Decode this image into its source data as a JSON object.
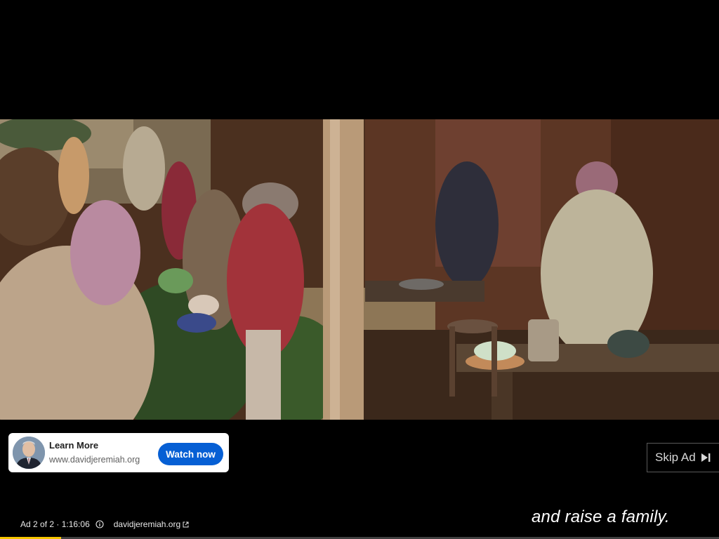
{
  "ad_card": {
    "title": "Learn More",
    "url": "www.davidjeremiah.org",
    "cta_label": "Watch now",
    "cta_color": "#065fd4"
  },
  "skip": {
    "label": "Skip Ad",
    "icon": "skip-next-icon"
  },
  "subtitle": {
    "text": "and raise a family."
  },
  "ad_info": {
    "position": "Ad 2 of 2 · 1:16:06",
    "info_icon": "info-icon",
    "advertiser_link": "davidjeremiah.org",
    "external_icon": "external-link-icon"
  },
  "progress": {
    "fraction": 0.085,
    "color": "#f7c600"
  }
}
